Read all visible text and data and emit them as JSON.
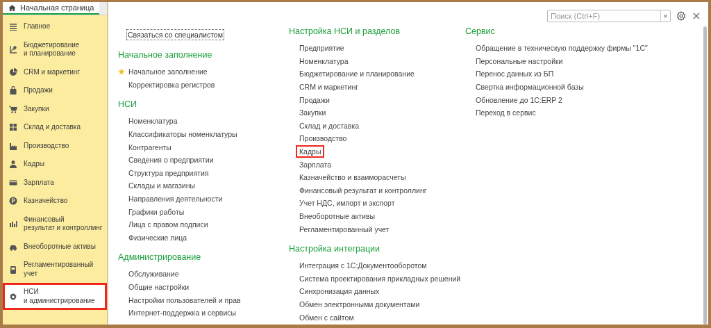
{
  "tabs": [
    {
      "label": "Начальная страница",
      "selected": true
    }
  ],
  "sidebar": {
    "items": [
      {
        "label": "Главное",
        "selected": false,
        "highlighted": false
      },
      {
        "label": "Бюджетирование\nи планирование",
        "selected": false,
        "highlighted": false
      },
      {
        "label": "CRM и маркетинг",
        "selected": false,
        "highlighted": false
      },
      {
        "label": "Продажи",
        "selected": false,
        "highlighted": false
      },
      {
        "label": "Закупки",
        "selected": false,
        "highlighted": false
      },
      {
        "label": "Склад и доставка",
        "selected": false,
        "highlighted": false
      },
      {
        "label": "Производство",
        "selected": false,
        "highlighted": false
      },
      {
        "label": "Кадры",
        "selected": false,
        "highlighted": false
      },
      {
        "label": "Зарплата",
        "selected": false,
        "highlighted": false
      },
      {
        "label": "Казначейство",
        "selected": false,
        "highlighted": false
      },
      {
        "label": "Финансовый\nрезультат и контроллинг",
        "selected": false,
        "highlighted": false
      },
      {
        "label": "Внеоборотные активы",
        "selected": false,
        "highlighted": false
      },
      {
        "label": "Регламентированный\nучет",
        "selected": false,
        "highlighted": false
      },
      {
        "label": "НСИ\nи администрирование",
        "selected": true,
        "highlighted": true
      }
    ]
  },
  "search": {
    "placeholder": "Поиск (Ctrl+F)",
    "clear": "×"
  },
  "columns": [
    {
      "contact_button": "Связаться со специалистом",
      "sections": [
        {
          "heading": "Начальное заполнение",
          "items": [
            {
              "label": "Начальное заполнение",
              "favorite": true,
              "highlighted": false
            },
            {
              "label": "Корректировка регистров",
              "favorite": false,
              "highlighted": false
            }
          ]
        },
        {
          "heading": "НСИ",
          "items": [
            {
              "label": "Номенклатура",
              "favorite": false,
              "highlighted": false
            },
            {
              "label": "Классификаторы номенклатуры",
              "favorite": false,
              "highlighted": false
            },
            {
              "label": "Контрагенты",
              "favorite": false,
              "highlighted": false
            },
            {
              "label": "Сведения о предприятии",
              "favorite": false,
              "highlighted": false
            },
            {
              "label": "Структура предприятия",
              "favorite": false,
              "highlighted": false
            },
            {
              "label": "Склады и магазины",
              "favorite": false,
              "highlighted": false
            },
            {
              "label": "Направления деятельности",
              "favorite": false,
              "highlighted": false
            },
            {
              "label": "Графики работы",
              "favorite": false,
              "highlighted": false
            },
            {
              "label": "Лица с правом подписи",
              "favorite": false,
              "highlighted": false
            },
            {
              "label": "Физические лица",
              "favorite": false,
              "highlighted": false
            }
          ]
        },
        {
          "heading": "Администрирование",
          "items": [
            {
              "label": "Обслуживание",
              "favorite": false,
              "highlighted": false
            },
            {
              "label": "Общие настройки",
              "favorite": false,
              "highlighted": false
            },
            {
              "label": "Настройки пользователей и прав",
              "favorite": false,
              "highlighted": false
            },
            {
              "label": "Интернет-поддержка и сервисы",
              "favorite": false,
              "highlighted": false
            }
          ]
        }
      ]
    },
    {
      "sections": [
        {
          "heading": "Настройка НСИ и разделов",
          "items": [
            {
              "label": "Предприятие",
              "favorite": false,
              "highlighted": false
            },
            {
              "label": "Номенклатура",
              "favorite": false,
              "highlighted": false
            },
            {
              "label": "Бюджетирование и планирование",
              "favorite": false,
              "highlighted": false
            },
            {
              "label": "CRM и маркетинг",
              "favorite": false,
              "highlighted": false
            },
            {
              "label": "Продажи",
              "favorite": false,
              "highlighted": false
            },
            {
              "label": "Закупки",
              "favorite": false,
              "highlighted": false
            },
            {
              "label": "Склад и доставка",
              "favorite": false,
              "highlighted": false
            },
            {
              "label": "Производство",
              "favorite": false,
              "highlighted": false
            },
            {
              "label": "Кадры",
              "favorite": false,
              "highlighted": true
            },
            {
              "label": "Зарплата",
              "favorite": false,
              "highlighted": false
            },
            {
              "label": "Казначейство и взаиморасчеты",
              "favorite": false,
              "highlighted": false
            },
            {
              "label": "Финансовый результат и контроллинг",
              "favorite": false,
              "highlighted": false
            },
            {
              "label": "Учет НДС, импорт и экспорт",
              "favorite": false,
              "highlighted": false
            },
            {
              "label": "Внеоборотные активы",
              "favorite": false,
              "highlighted": false
            },
            {
              "label": "Регламентированный учет",
              "favorite": false,
              "highlighted": false
            }
          ]
        },
        {
          "heading": "Настройка интеграции",
          "items": [
            {
              "label": "Интеграция с 1С:Документооборотом",
              "favorite": false,
              "highlighted": false
            },
            {
              "label": "Система проектирования прикладных решений",
              "favorite": false,
              "highlighted": false
            },
            {
              "label": "Синхронизация данных",
              "favorite": false,
              "highlighted": false
            },
            {
              "label": "Обмен электронными документами",
              "favorite": false,
              "highlighted": false
            },
            {
              "label": "Обмен с сайтом",
              "favorite": false,
              "highlighted": false
            }
          ]
        }
      ]
    },
    {
      "sections": [
        {
          "heading": "Сервис",
          "items": [
            {
              "label": "Обращение в техническую поддержку фирмы \"1С\"",
              "favorite": false,
              "highlighted": false
            },
            {
              "label": "Персональные настройки",
              "favorite": false,
              "highlighted": false
            },
            {
              "label": "Перенос данных из БП",
              "favorite": false,
              "highlighted": false
            },
            {
              "label": "Свертка информационной базы",
              "favorite": false,
              "highlighted": false
            },
            {
              "label": "Обновление до 1С:ERP 2",
              "favorite": false,
              "highlighted": false
            },
            {
              "label": "Переход в сервис",
              "favorite": false,
              "highlighted": false
            }
          ]
        }
      ]
    }
  ]
}
